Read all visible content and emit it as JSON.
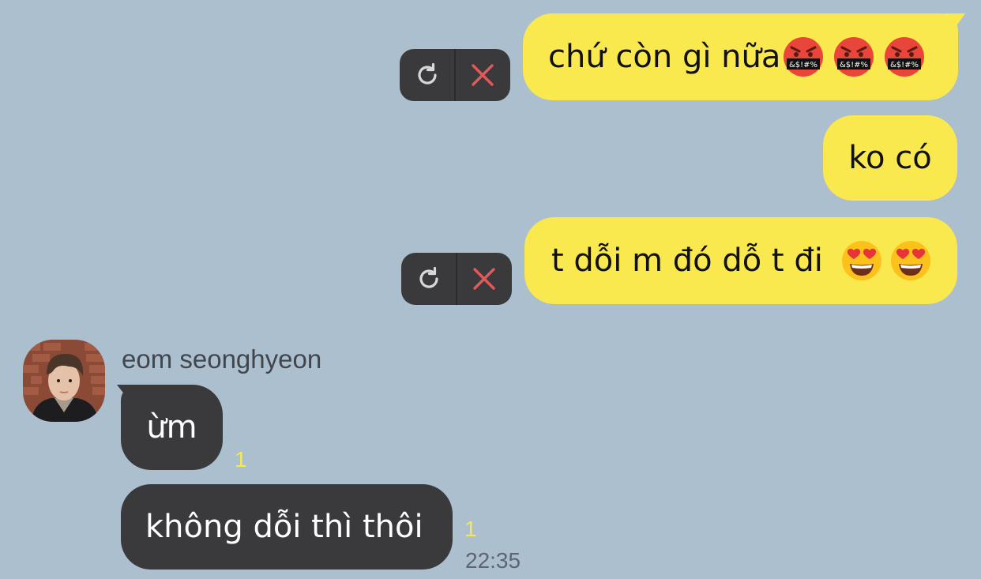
{
  "messages_sent": [
    {
      "text": "chứ còn gì nữa",
      "emoji": [
        "swearing-face",
        "swearing-face",
        "swearing-face"
      ],
      "status": "failed"
    },
    {
      "text": "ko có",
      "emoji": [],
      "status": "sent"
    },
    {
      "text": "t dỗi m đó dỗ t đi",
      "emoji": [
        "heart-eyes-face",
        "heart-eyes-face"
      ],
      "status": "failed"
    }
  ],
  "contact": {
    "name": "eom seonghyeon"
  },
  "messages_received": [
    {
      "text": "ừm",
      "unread_count": "1"
    },
    {
      "text": "không dỗi thì thôi",
      "unread_count": "1",
      "time": "22:35"
    }
  ],
  "icons": {
    "retry": "retry-icon",
    "cancel": "close-icon"
  },
  "colors": {
    "background": "#abbfcf",
    "outgoing_bubble": "#fae84f",
    "incoming_bubble": "#3a3a3d",
    "unread": "#f4e75a",
    "cancel_x": "#e05a5a"
  }
}
